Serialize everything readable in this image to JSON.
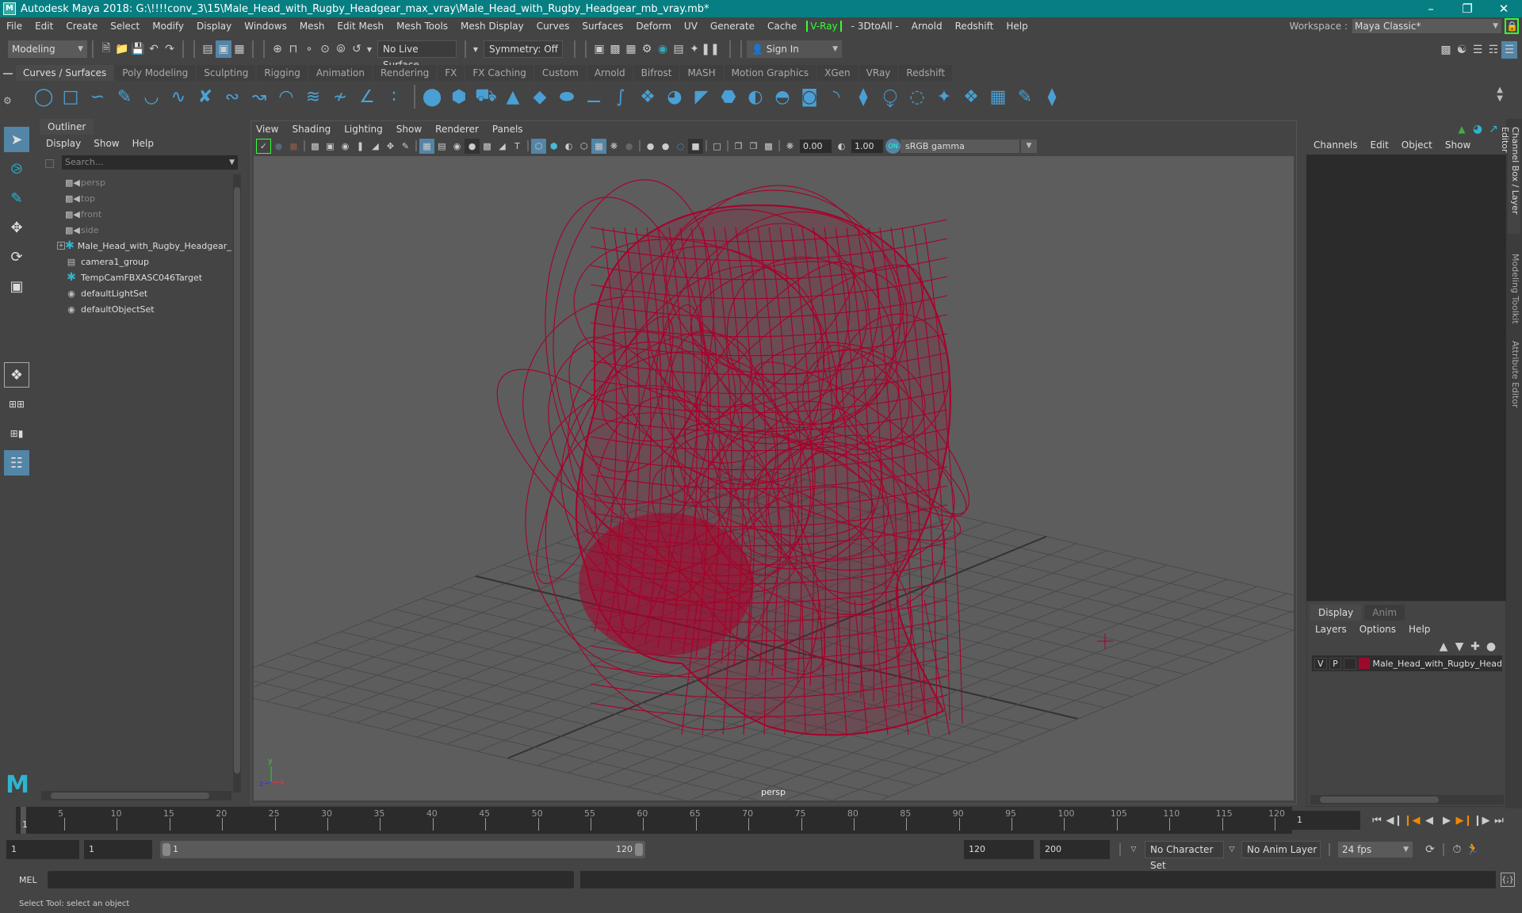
{
  "window": {
    "title": "Autodesk Maya 2018: G:\\!!!!conv_3\\15\\Male_Head_with_Rugby_Headgear_max_vray\\Male_Head_with_Rugby_Headgear_mb_vray.mb*",
    "minimize_icon": "minimize-icon",
    "restore_icon": "restore-icon",
    "close_icon": "close-icon"
  },
  "menubar": [
    "File",
    "Edit",
    "Create",
    "Select",
    "Modify",
    "Display",
    "Windows",
    "Mesh",
    "Edit Mesh",
    "Mesh Tools",
    "Mesh Display",
    "Curves",
    "Surfaces",
    "Deform",
    "UV",
    "Generate",
    "Cache",
    "V-Ray",
    "- 3DtoAll -",
    "Arnold",
    "Redshift",
    "Help"
  ],
  "workspace": {
    "label": "Workspace :",
    "value": "Maya Classic*"
  },
  "statusline": {
    "mode": "Modeling",
    "live_surface": "No Live Surface",
    "symmetry": "Symmetry: Off",
    "sign_in": "Sign In"
  },
  "shelf_tabs": [
    "Curves / Surfaces",
    "Poly Modeling",
    "Sculpting",
    "Rigging",
    "Animation",
    "Rendering",
    "FX",
    "FX Caching",
    "Custom",
    "Arnold",
    "Bifrost",
    "MASH",
    "Motion Graphics",
    "XGen",
    "VRay",
    "Redshift"
  ],
  "shelf_active_tab": "Curves / Surfaces",
  "outliner": {
    "tab": "Outliner",
    "menu": [
      "Display",
      "Show",
      "Help"
    ],
    "search_placeholder": "Search...",
    "items": [
      {
        "label": "persp",
        "icon": "camera-icon",
        "dim": true
      },
      {
        "label": "top",
        "icon": "camera-icon",
        "dim": true
      },
      {
        "label": "front",
        "icon": "camera-icon",
        "dim": true
      },
      {
        "label": "side",
        "icon": "camera-icon",
        "dim": true
      },
      {
        "label": "Male_Head_with_Rugby_Headgear_n",
        "icon": "transform-icon",
        "expandable": true
      },
      {
        "label": "camera1_group",
        "icon": "group-icon"
      },
      {
        "label": "TempCamFBXASC046Target",
        "icon": "transform-icon"
      },
      {
        "label": "defaultLightSet",
        "icon": "set-icon"
      },
      {
        "label": "defaultObjectSet",
        "icon": "set-icon"
      }
    ]
  },
  "viewport": {
    "menu": [
      "View",
      "Shading",
      "Lighting",
      "Show",
      "Renderer",
      "Panels"
    ],
    "exposure": "0.00",
    "gamma": "1.00",
    "color_space": "sRGB gamma",
    "camera_label": "persp",
    "axis": {
      "x": "x",
      "y": "y",
      "z": "z"
    },
    "wireframe_color": "#a8002a"
  },
  "channel_box": {
    "menu": [
      "Channels",
      "Edit",
      "Object",
      "Show"
    ]
  },
  "layer_editor": {
    "tabs": [
      "Display",
      "Anim"
    ],
    "menu": [
      "Layers",
      "Options",
      "Help"
    ],
    "layers": [
      {
        "v": "V",
        "p": "P",
        "color": "#9b0a2c",
        "name": "Male_Head_with_Rugby_Head"
      }
    ]
  },
  "side_tabs": [
    "Channel Box / Layer Editor",
    "Modeling Toolkit",
    "Attribute Editor"
  ],
  "timeline": {
    "ticks": [
      5,
      10,
      15,
      20,
      25,
      30,
      35,
      40,
      45,
      50,
      55,
      60,
      65,
      70,
      75,
      80,
      85,
      90,
      95,
      100,
      105,
      110,
      115,
      120
    ],
    "current_frame": "1",
    "current_frame_field": "1"
  },
  "range": {
    "start": "1",
    "playback_start": "1",
    "slider_start": "1",
    "slider_end": "120",
    "playback_end": "120",
    "end": "200",
    "character_set": "No Character Set",
    "anim_layer": "No Anim Layer",
    "fps": "24 fps"
  },
  "command_line": {
    "label": "MEL",
    "value": ""
  },
  "help_line": "Select Tool: select an object"
}
